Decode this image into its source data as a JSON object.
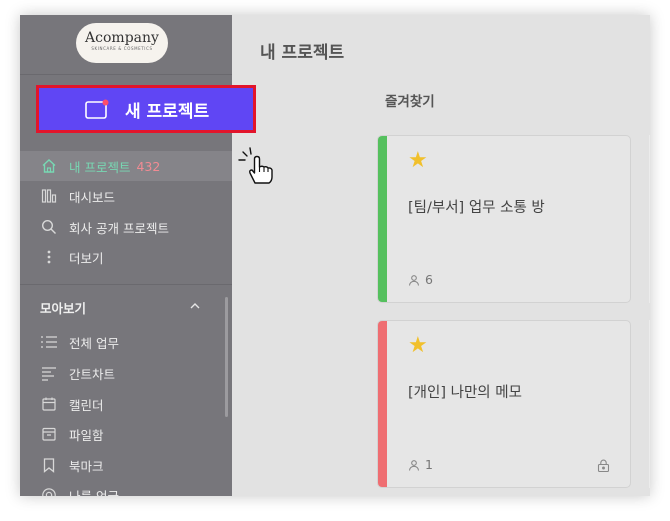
{
  "logo": {
    "name": "Acompany",
    "tagline": "SKINCARE & COSMETICS"
  },
  "new_project": {
    "label": "새 프로젝트"
  },
  "nav": [
    {
      "label": "내 프로젝트",
      "count": "432",
      "icon": "home-icon"
    },
    {
      "label": "대시보드",
      "icon": "dashboard-icon"
    },
    {
      "label": "회사 공개 프로젝트",
      "icon": "search-icon"
    },
    {
      "label": "더보기",
      "icon": "more-vertical-icon"
    }
  ],
  "collection": {
    "title": "모아보기",
    "items": [
      {
        "label": "전체 업무",
        "icon": "list-icon"
      },
      {
        "label": "간트차트",
        "icon": "gantt-icon"
      },
      {
        "label": "캘린더",
        "icon": "calendar-icon"
      },
      {
        "label": "파일함",
        "icon": "archive-icon"
      },
      {
        "label": "북마크",
        "icon": "bookmark-icon"
      },
      {
        "label": "나를 언급",
        "icon": "mention-icon"
      }
    ]
  },
  "main": {
    "title": "내 프로젝트",
    "favorites_title": "즐겨찾기",
    "cards": [
      {
        "title": "[팀/부서] 업무 소통 방",
        "members": "6",
        "starred": true,
        "locked": false
      },
      {
        "title": "[개인] 나만의 메모",
        "members": "1",
        "starred": true,
        "locked": true
      }
    ]
  },
  "colors": {
    "sidebar_bg": "#77767b",
    "accent_button": "#6046f4",
    "button_outline": "#e2142b",
    "active_text": "#78d8b3",
    "count_text": "#f08b93",
    "star": "#f1c02c",
    "card1_stripe": "#55c05e",
    "card2_stripe": "#ef6e72"
  }
}
